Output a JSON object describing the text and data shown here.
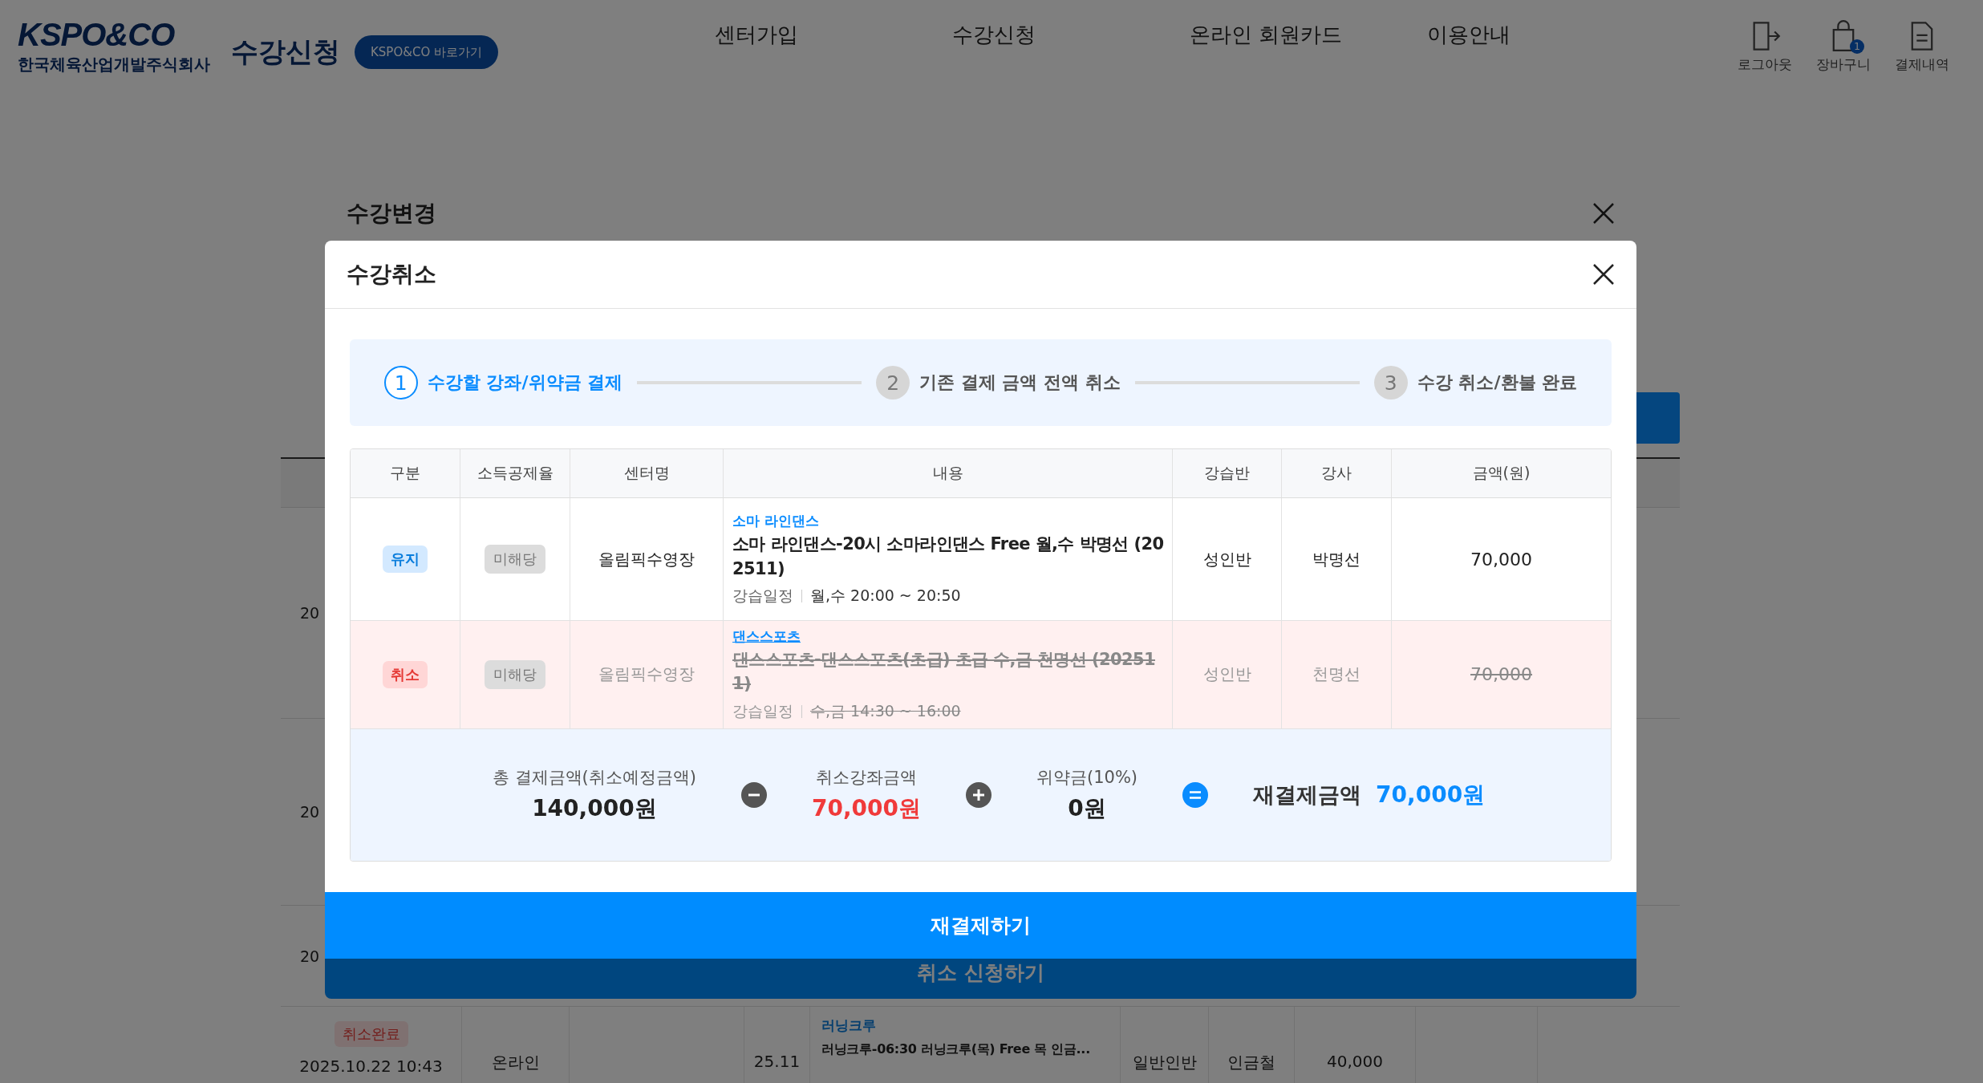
{
  "header": {
    "logo": "KSPO&CO",
    "company": "한국체육산업개발주식회사",
    "title": "수강신청",
    "shortcut": "KSPO&CO 바로가기",
    "nav": [
      "센터가입",
      "수강신청",
      "온라인 회원카드",
      "이용안내"
    ],
    "utilities": [
      {
        "kind": "logout",
        "label": "로그아웃"
      },
      {
        "kind": "cart",
        "label": "장바구니",
        "count": "1"
      },
      {
        "kind": "receipt",
        "label": "결제내역"
      }
    ]
  },
  "background_rows": [
    {
      "date": "20"
    },
    {
      "date": "20"
    },
    {
      "date": "20"
    }
  ],
  "background_last_row": {
    "status": "취소완료",
    "date": "2025.10.22 10:43",
    "type": "온라인",
    "month": "25.11",
    "category": "러닝크루",
    "course": "러닝크루-06:30 러닝크루(목) Free 목 인금...",
    "class": "일반인반",
    "instructor": "인금철",
    "amount": "40,000"
  },
  "change_modal": {
    "title": "수강변경",
    "button": "취소 신청하기"
  },
  "cancel_modal": {
    "title": "수강취소",
    "steps": [
      {
        "number": "1",
        "label": "수강할 강좌/위약금 결제",
        "selected": true
      },
      {
        "number": "2",
        "label": "기존 결제 금액 전액 취소",
        "selected": false
      },
      {
        "number": "3",
        "label": "수강 취소/환불 완료",
        "selected": false
      }
    ],
    "columns": [
      "구분",
      "소득공제율",
      "센터명",
      "내용",
      "강습반",
      "강사",
      "금액(원)"
    ],
    "rows": [
      {
        "kind": "keep",
        "status": "유지",
        "deduction": "미해당",
        "center": "올림픽수영장",
        "category": "소마 라인댄스",
        "course": "소마 라인댄스-20시 소마라인댄스 Free 월,수 박명선 (202511)",
        "schedule_label": "강습일정",
        "schedule": "월,수 20:00 ~ 20:50",
        "class": "성인반",
        "instructor": "박명선",
        "amount": "70,000"
      },
      {
        "kind": "cancel",
        "status": "취소",
        "deduction": "미해당",
        "center": "올림픽수영장",
        "category": "댄스스포츠",
        "course": "댄스스포츠-댄스스포츠(초급) 초급 수,금 천명선 (202511)",
        "schedule_label": "강습일정",
        "schedule": "수,금 14:30 ~ 16:00",
        "class": "성인반",
        "instructor": "천명선",
        "amount": "70,000"
      }
    ],
    "summary": {
      "total_label": "총 결제금액(취소예정금액)",
      "total": "140,000원",
      "cancel_label": "취소강좌금액",
      "cancel": "70,000원",
      "penalty_label": "위약금(10%)",
      "penalty": "0원",
      "result_label": "재결제금액",
      "result": "70,000원"
    },
    "button": "재결제하기"
  }
}
